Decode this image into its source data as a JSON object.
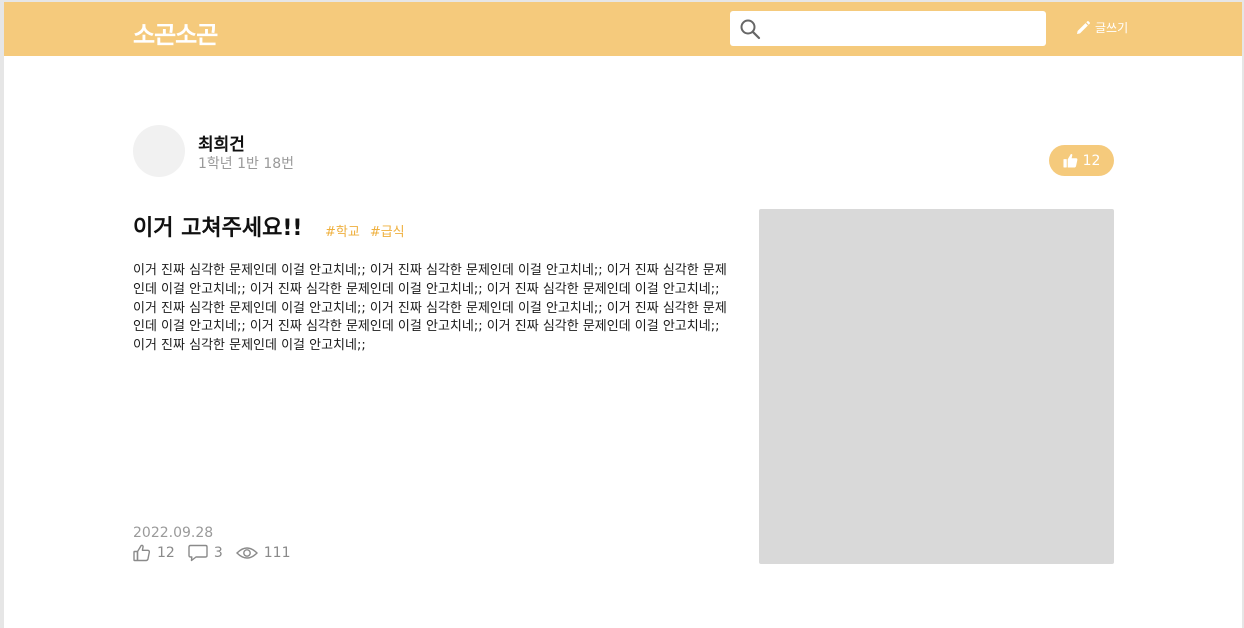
{
  "app": {
    "logo": "소곤소곤"
  },
  "navbar": {
    "search_placeholder": "",
    "write_label": "글쓰기"
  },
  "author": {
    "name": "최희건",
    "class_info": "1학년 1반 18번"
  },
  "like_button": {
    "count": "12"
  },
  "post": {
    "title": "이거 고쳐주세요!!",
    "tags": [
      "#학교",
      "#급식"
    ],
    "body": "이거 진짜 심각한 문제인데 이걸 안고치네;; 이거 진짜 심각한 문제인데 이걸 안고치네;; 이거 진짜 심각한 문제인데 이걸 안고치네;; 이거 진짜 심각한 문제인데 이걸 안고치네;; 이거 진짜 심각한 문제인데 이걸 안고치네;; 이거 진짜 심각한 문제인데 이걸 안고치네;; 이거 진짜 심각한 문제인데 이걸 안고치네;; 이거 진짜 심각한 문제인데 이걸 안고치네;; 이거 진짜 심각한 문제인데 이걸 안고치네;; 이거 진짜 심각한 문제인데 이걸 안고치네;; 이거 진짜 심각한 문제인데 이걸 안고치네;;",
    "date": "2022.09.28",
    "likes": "12",
    "comments": "3",
    "views": "111"
  },
  "colors": {
    "accent": "#f5ca7c",
    "tag": "#efb03e",
    "image_placeholder": "#d9d9d9"
  },
  "icons": {
    "search": "search-icon",
    "write": "pencil-icon",
    "like": "thumbs-up-icon",
    "comment": "comment-icon",
    "views": "eye-icon"
  }
}
